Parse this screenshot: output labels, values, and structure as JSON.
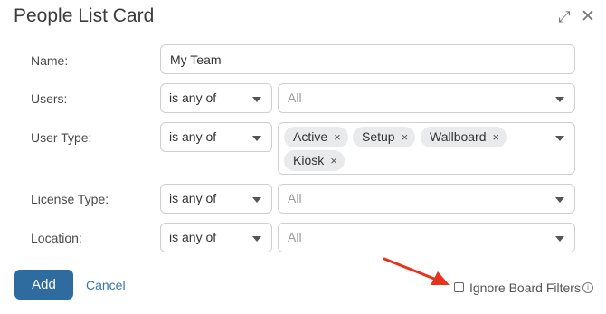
{
  "dialog": {
    "title": "People List Card",
    "expand_icon": "expand-icon",
    "close_icon": "close-icon"
  },
  "form": {
    "name": {
      "label": "Name:",
      "value": "My Team"
    },
    "users": {
      "label": "Users:",
      "operator": "is any of",
      "placeholder": "All"
    },
    "user_type": {
      "label": "User Type:",
      "operator": "is any of",
      "chips": [
        "Active",
        "Setup",
        "Wallboard",
        "Kiosk"
      ],
      "chip_remove_glyph": "×"
    },
    "license_type": {
      "label": "License Type:",
      "operator": "is any of",
      "placeholder": "All"
    },
    "location": {
      "label": "Location:",
      "operator": "is any of",
      "placeholder": "All"
    }
  },
  "footer": {
    "add_label": "Add",
    "cancel_label": "Cancel",
    "ignore_board_filters_label": "Ignore Board Filters",
    "ignore_board_filters_checked": false
  },
  "colors": {
    "primary": "#2e6b9e",
    "link": "#3476b0",
    "chip_bg": "#e9eaec",
    "annotation_arrow": "#e8321e"
  }
}
